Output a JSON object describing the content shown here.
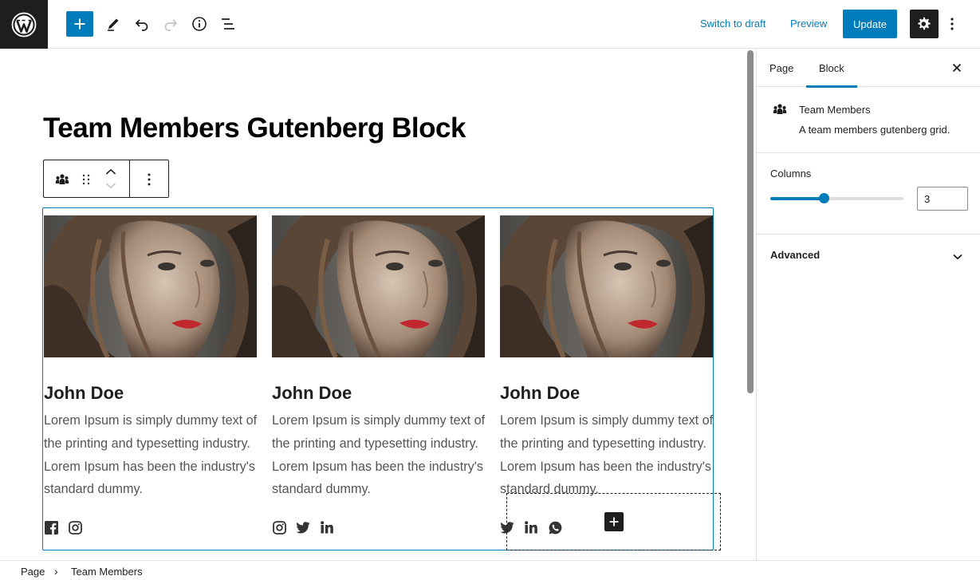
{
  "toolbar": {
    "switch_to_draft": "Switch to draft",
    "preview": "Preview",
    "update": "Update",
    "icons": [
      "wordpress-logo",
      "plus-icon",
      "pencil-icon",
      "undo-icon",
      "redo-icon",
      "info-icon",
      "list-view-icon",
      "gear-icon",
      "more-vertical-icon"
    ]
  },
  "editor": {
    "title": "Team Members Gutenberg Block",
    "members": [
      {
        "name": "John Doe",
        "bio": "Lorem Ipsum is simply dummy text of the printing and typesetting industry. Lorem Ipsum has been the industry's standard dummy.",
        "social": [
          "facebook",
          "instagram"
        ]
      },
      {
        "name": "John Doe",
        "bio": "Lorem Ipsum is simply dummy text of the printing and typesetting industry. Lorem Ipsum has been the industry's standard dummy.",
        "social": [
          "instagram",
          "twitter",
          "linkedin"
        ]
      },
      {
        "name": "John Doe",
        "bio": "Lorem Ipsum is simply dummy text of the printing and typesetting industry. Lorem Ipsum has been the industry's standard dummy.",
        "social": [
          "twitter",
          "linkedin",
          "whatsapp"
        ]
      }
    ]
  },
  "sidebar": {
    "tabs": {
      "page": "Page",
      "block": "Block"
    },
    "active_tab": "Block",
    "block": {
      "name": "Team Members",
      "description": "A team members gutenberg grid."
    },
    "columns": {
      "label": "Columns",
      "value": "3",
      "min": 1,
      "max": 6
    },
    "advanced": "Advanced"
  },
  "breadcrumb": {
    "root": "Page",
    "separator": "›",
    "current": "Team Members"
  },
  "colors": {
    "accent": "#007cba",
    "dark": "#1e1e1e",
    "lip": "#c0282d"
  }
}
